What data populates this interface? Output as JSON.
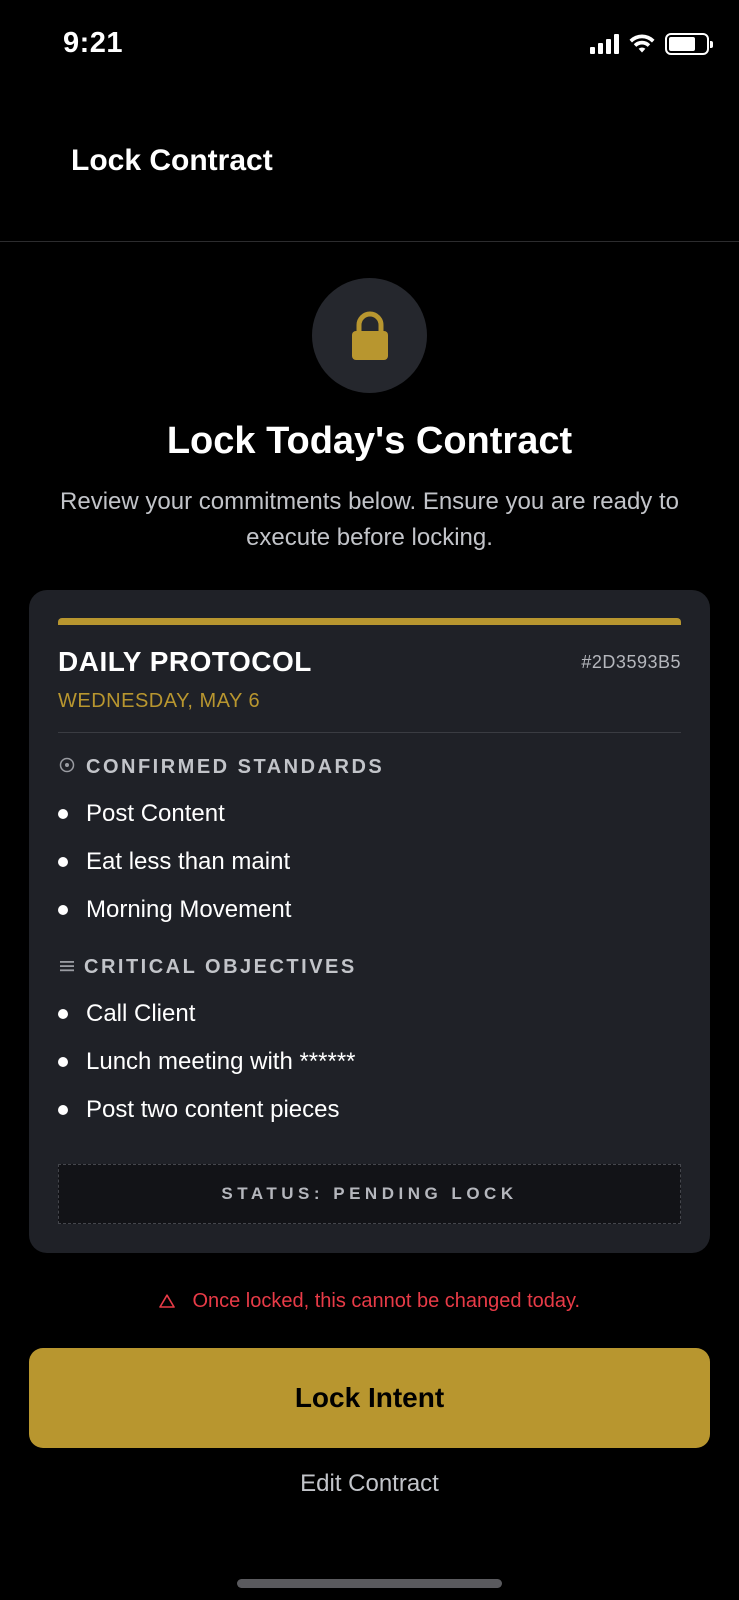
{
  "status_bar": {
    "time": "9:21",
    "battery_level": 0.72
  },
  "header": {
    "title": "Lock Contract"
  },
  "intro": {
    "title": "Lock Today's Contract",
    "subtitle": "Review your commitments below. Ensure you are ready to execute before locking."
  },
  "card": {
    "title": "DAILY PROTOCOL",
    "id": "#2D3593B5",
    "date": "WEDNESDAY, MAY 6",
    "sections": [
      {
        "heading": "CONFIRMED STANDARDS",
        "icon": "target-icon",
        "items": [
          "Post Content",
          "Eat less than maint",
          "Morning Movement"
        ]
      },
      {
        "heading": "CRITICAL OBJECTIVES",
        "icon": "list-icon",
        "items": [
          "Call Client",
          "Lunch meeting with ******",
          "Post two content pieces"
        ]
      }
    ],
    "status": "STATUS: PENDING LOCK"
  },
  "warning": {
    "text": "Once locked, this cannot be changed today.",
    "icon": "warning-triangle-icon"
  },
  "actions": {
    "primary": "Lock Intent",
    "secondary": "Edit Contract"
  },
  "colors": {
    "accent": "#b8962f",
    "warning": "#e83b47",
    "card_bg": "#1f2127"
  }
}
